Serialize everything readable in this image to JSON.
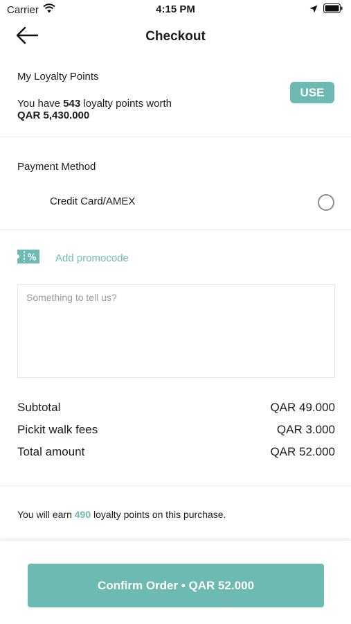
{
  "status_bar": {
    "carrier": "Carrier",
    "time": "4:15 PM",
    "icons": [
      "wifi-icon",
      "location-arrow-icon",
      "battery-icon"
    ]
  },
  "header": {
    "title": "Checkout",
    "back_icon": "arrow-left-icon"
  },
  "loyalty": {
    "title": "My Loyalty Points",
    "text_prefix": "You have",
    "points": "543",
    "text_suffix": "loyalty points worth",
    "worth": "QAR 5,430.000",
    "use_label": "USE"
  },
  "payment": {
    "title": "Payment Method",
    "option_label": "Credit Card/AMEX",
    "selected": false
  },
  "promo": {
    "icon": "ticket-percent-icon",
    "label": "Add promocode"
  },
  "notes": {
    "placeholder": "Something to tell us?",
    "value": ""
  },
  "summary": {
    "rows": [
      {
        "label": "Subtotal",
        "value": "QAR  49.000"
      },
      {
        "label": "Pickit walk fees",
        "value": "QAR  3.000"
      },
      {
        "label": "Total amount",
        "value": "QAR  52.000"
      }
    ]
  },
  "earn": {
    "prefix": "You will earn",
    "points": "490",
    "suffix": "loyalty points on this purchase."
  },
  "confirm": {
    "label": "Confirm Order • QAR  52.000"
  },
  "colors": {
    "accent": "#6cbab1",
    "text": "#1b1b1b"
  }
}
